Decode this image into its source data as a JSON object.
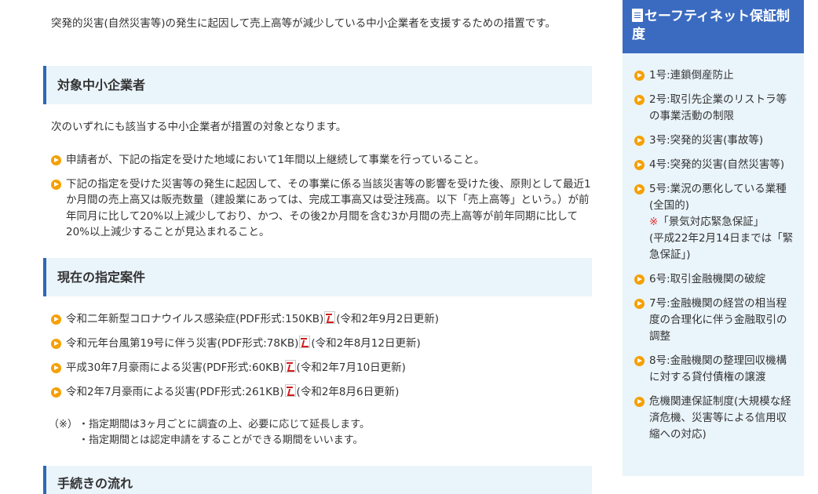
{
  "intro": "突発的災害(自然災害等)の発生に起因して売上高等が減少している中小企業者を支援するための措置です。",
  "section1": {
    "title": "対象中小企業者",
    "lead": "次のいずれにも該当する中小企業者が措置の対象となります。",
    "items": [
      "申請者が、下記の指定を受けた地域において1年間以上継続して事業を行っていること。",
      "下記の指定を受けた災害等の発生に起因して、その事業に係る当該災害等の影響を受けた後、原則として最近1か月間の売上高又は販売数量（建設業にあっては、完成工事高又は受注残高。以下「売上高等」という。）が前年同月に比して20%以上減少しており、かつ、その後2か月間を含む3か月間の売上高等が前年同期に比して20%以上減少することが見込まれること。"
    ]
  },
  "section2": {
    "title": "現在の指定案件",
    "cases": [
      {
        "link": "令和二年新型コロナウイルス感染症(PDF形式:150KB)",
        "date": "(令和2年9月2日更新)"
      },
      {
        "link": "令和元年台風第19号に伴う災害(PDF形式:78KB)",
        "date": "(令和2年8月12日更新)"
      },
      {
        "link": "平成30年7月豪雨による災害(PDF形式:60KB)",
        "date": "(令和2年7月10日更新)"
      },
      {
        "link": "令和2年7月豪雨による災害(PDF形式:261KB)",
        "date": "(令和2年8月6日更新)"
      }
    ],
    "note_mark": "（※）",
    "notes": [
      "・指定期間は3ヶ月ごとに調査の上、必要に応じて延長します。",
      "・指定期間とは認定申請をすることができる期間をいいます。"
    ]
  },
  "section3": {
    "title": "手続きの流れ"
  },
  "sidebar": {
    "title": "セーフティネット保証制度",
    "items": [
      {
        "text": "1号:連鎖倒産防止"
      },
      {
        "text": "2号:取引先企業のリストラ等の事業活動の制限"
      },
      {
        "text": "3号:突発的災害(事故等)"
      },
      {
        "text": "4号:突発的災害(自然災害等)"
      },
      {
        "text": "5号:業況の悪化している業種(全国的)",
        "note_mark": "※",
        "note": "「景気対応緊急保証」",
        "note2": "(平成22年2月14日までは「緊急保証」)"
      },
      {
        "text": "6号:取引金融機関の破綻"
      },
      {
        "text": "7号:金融機関の経営の相当程度の合理化に伴う金融取引の調整"
      },
      {
        "text": "8号:金融機関の整理回収機構に対する貸付債権の譲渡"
      },
      {
        "text": "危機関連保証制度(大規模な経済危機、災害等による信用収縮への対応)"
      }
    ]
  },
  "colors": {
    "accent": "#2f67b4",
    "sidebar_header": "#3b6bc0",
    "bullet": "#f5a000",
    "panel": "#eaf4fb",
    "note_red": "#e03030"
  },
  "icons": {
    "bullet": "orange-arrow-circle-icon",
    "pdf": "pdf-icon",
    "doc": "document-icon"
  }
}
